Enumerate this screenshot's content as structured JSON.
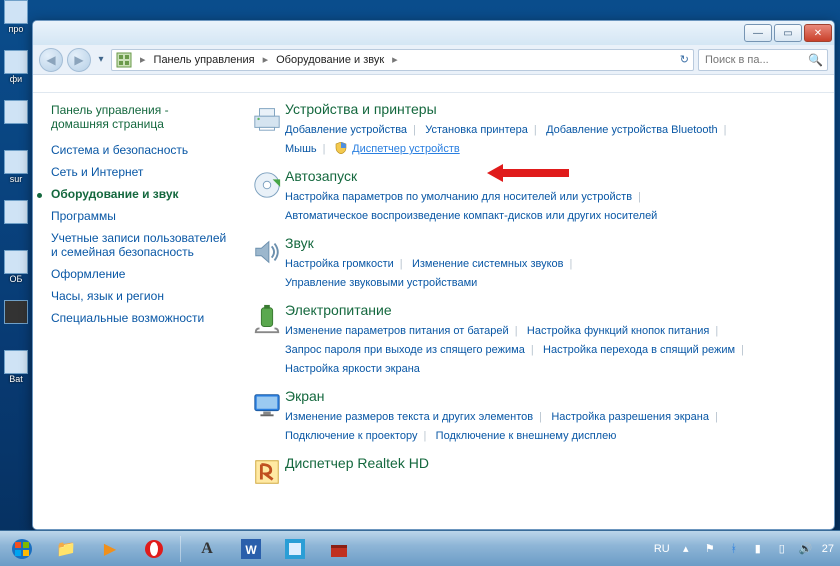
{
  "breadcrumb": {
    "seg1": "Панель управления",
    "seg2": "Оборудование и звук"
  },
  "search": {
    "placeholder": "Поиск в па..."
  },
  "sidebar": {
    "home_line1": "Панель управления -",
    "home_line2": "домашняя страница",
    "items": [
      {
        "label": "Система и безопасность"
      },
      {
        "label": "Сеть и Интернет"
      },
      {
        "label": "Оборудование и звук"
      },
      {
        "label": "Программы"
      },
      {
        "label": "Учетные записи пользователей и семейная безопасность"
      },
      {
        "label": "Оформление"
      },
      {
        "label": "Часы, язык и регион"
      },
      {
        "label": "Специальные возможности"
      }
    ]
  },
  "sections": [
    {
      "title": "Устройства и принтеры",
      "links": [
        {
          "t": "Добавление устройства"
        },
        {
          "t": "Установка принтера"
        },
        {
          "t": "Добавление устройства Bluetooth"
        },
        {
          "t": "Мышь"
        },
        {
          "t": "Диспетчер устройств",
          "shield": true,
          "highlight": true
        }
      ]
    },
    {
      "title": "Автозапуск",
      "links": [
        {
          "t": "Настройка параметров по умолчанию для носителей или устройств"
        },
        {
          "t": "Автоматическое воспроизведение компакт-дисков или других носителей"
        }
      ]
    },
    {
      "title": "Звук",
      "links": [
        {
          "t": "Настройка громкости"
        },
        {
          "t": "Изменение системных звуков"
        },
        {
          "t": "Управление звуковыми устройствами"
        }
      ]
    },
    {
      "title": "Электропитание",
      "links": [
        {
          "t": "Изменение параметров питания от батарей"
        },
        {
          "t": "Настройка функций кнопок питания"
        },
        {
          "t": "Запрос пароля при выходе из спящего режима"
        },
        {
          "t": "Настройка перехода в спящий режим"
        },
        {
          "t": "Настройка яркости экрана"
        }
      ]
    },
    {
      "title": "Экран",
      "links": [
        {
          "t": "Изменение размеров текста и других элементов"
        },
        {
          "t": "Настройка разрешения экрана"
        },
        {
          "t": "Подключение к проектору"
        },
        {
          "t": "Подключение к внешнему дисплею"
        }
      ]
    },
    {
      "title": "Диспетчер Realtek HD",
      "links": []
    }
  ],
  "tray": {
    "lang": "RU"
  },
  "systray_date_frag": "27"
}
